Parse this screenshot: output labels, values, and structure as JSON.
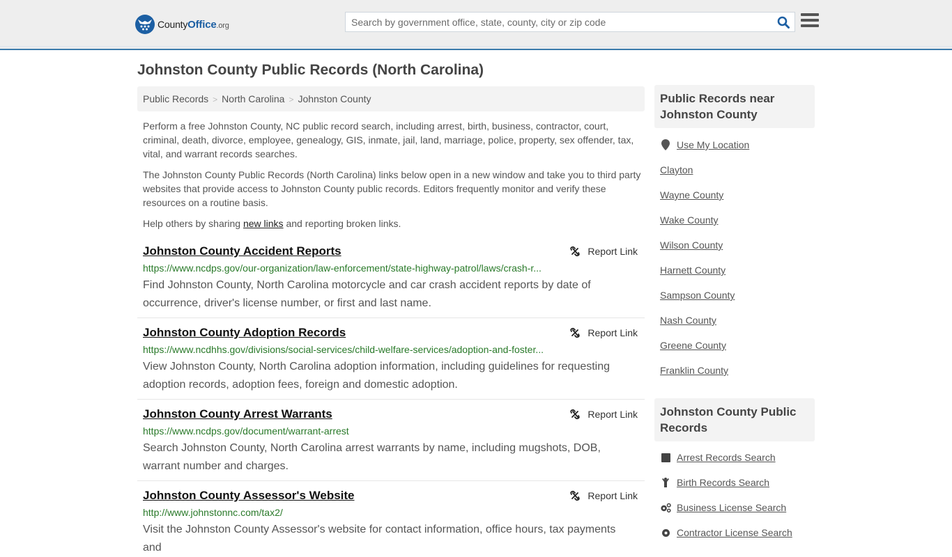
{
  "header": {
    "logo": {
      "county": "County",
      "office": "Office",
      "org": ".org"
    },
    "search": {
      "placeholder": "Search by government office, state, county, city or zip code",
      "value": ""
    },
    "search_icon": "search-icon",
    "menu_icon": "hamburger-menu-icon"
  },
  "page": {
    "title": "Johnston County Public Records (North Carolina)"
  },
  "breadcrumb": [
    {
      "label": "Public Records"
    },
    {
      "label": "North Carolina"
    },
    {
      "label": "Johnston County"
    }
  ],
  "intro": {
    "p1": "Perform a free Johnston County, NC public record search, including arrest, birth, business, contractor, court, criminal, death, divorce, employee, genealogy, GIS, inmate, jail, land, marriage, police, property, sex offender, tax, vital, and warrant records searches.",
    "p2": "The Johnston County Public Records (North Carolina) links below open in a new window and take you to third party websites that provide access to Johnston County public records. Editors frequently monitor and verify these resources on a routine basis.",
    "p3_before": "Help others by sharing ",
    "p3_link": "new links",
    "p3_after": " and reporting broken links."
  },
  "results": [
    {
      "title": "Johnston County Accident Reports",
      "url": "https://www.ncdps.gov/our-organization/law-enforcement/state-highway-patrol/laws/crash-r...",
      "description": "Find Johnston County, North Carolina motorcycle and car crash accident reports by date of occurrence, driver's license number, or first and last name.",
      "report_label": "Report Link"
    },
    {
      "title": "Johnston County Adoption Records",
      "url": "https://www.ncdhhs.gov/divisions/social-services/child-welfare-services/adoption-and-foster...",
      "description": "View Johnston County, North Carolina adoption information, including guidelines for requesting adoption records, adoption fees, foreign and domestic adoption.",
      "report_label": "Report Link"
    },
    {
      "title": "Johnston County Arrest Warrants",
      "url": "https://www.ncdps.gov/document/warrant-arrest",
      "description": "Search Johnston County, North Carolina arrest warrants by name, including mugshots, DOB, warrant number and charges.",
      "report_label": "Report Link"
    },
    {
      "title": "Johnston County Assessor's Website",
      "url": "http://www.johnstonnc.com/tax2/",
      "description": "Visit the Johnston County Assessor's website for contact information, office hours, tax payments and",
      "report_label": "Report Link"
    }
  ],
  "sidebar": {
    "nearby": {
      "heading": "Public Records near Johnston County",
      "location_label": "Use My Location",
      "items": [
        "Clayton",
        "Wayne County",
        "Wake County",
        "Wilson County",
        "Harnett County",
        "Sampson County",
        "Nash County",
        "Greene County",
        "Franklin County"
      ]
    },
    "records": {
      "heading": "Johnston County Public Records",
      "items": [
        {
          "label": "Arrest Records Search",
          "icon": "arrest-square-icon"
        },
        {
          "label": "Birth Records Search",
          "icon": "child-icon"
        },
        {
          "label": "Business License Search",
          "icon": "cogs-icon"
        },
        {
          "label": "Contractor License Search",
          "icon": "gear-icon"
        }
      ]
    }
  },
  "colors": {
    "brand": "#1c5fa3",
    "accent_border": "#3b7bab",
    "url_green": "#2a7a2a"
  }
}
